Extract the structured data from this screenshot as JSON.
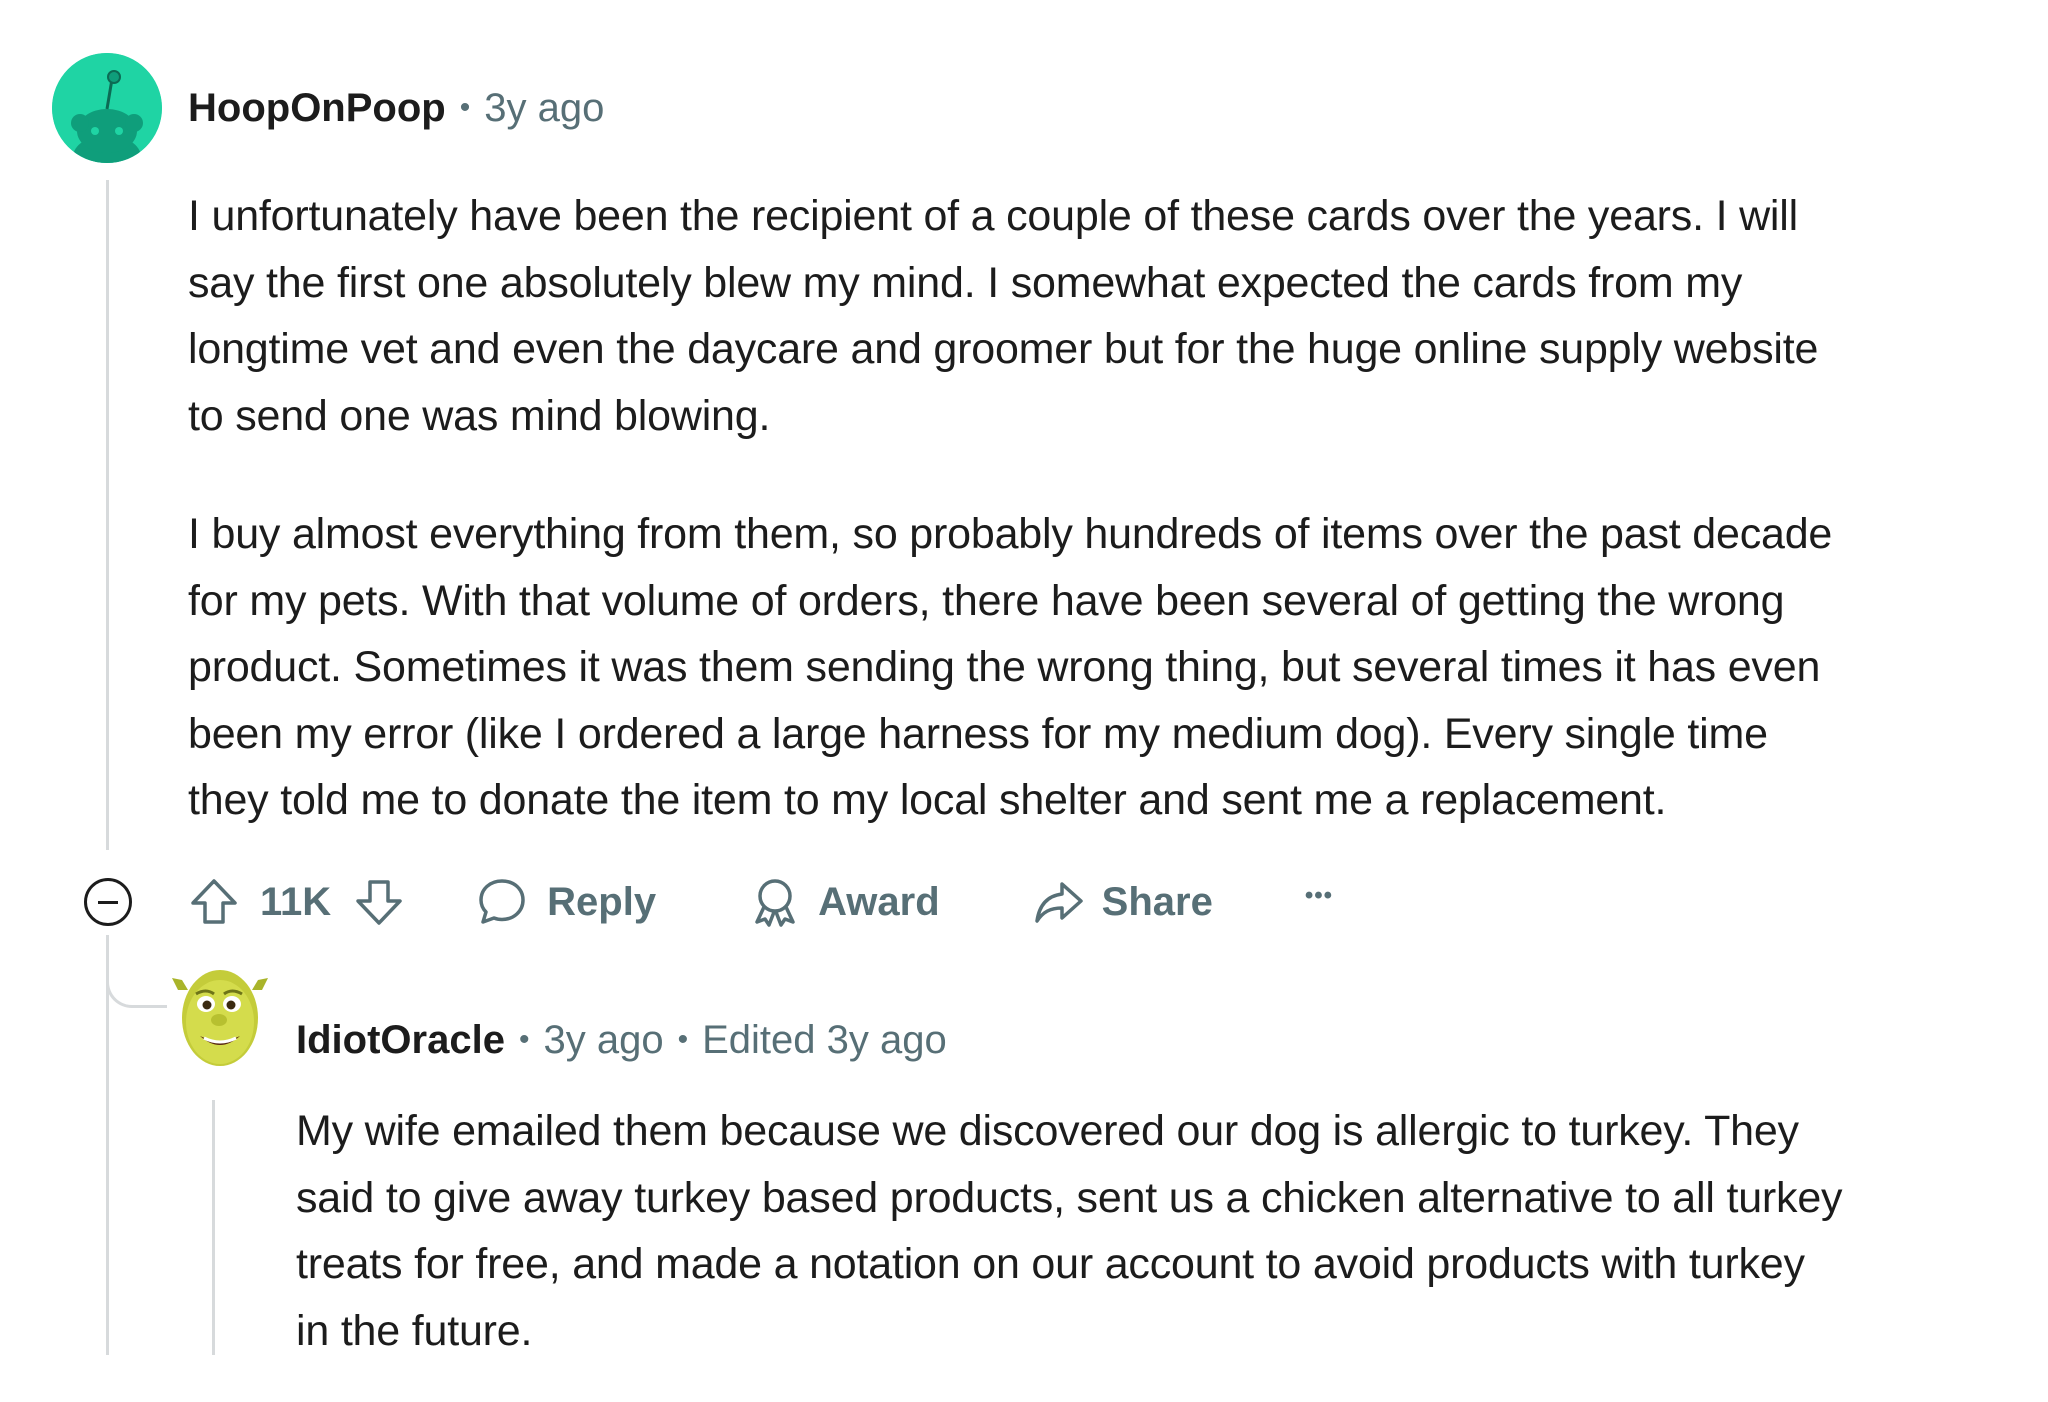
{
  "comment": {
    "username": "HoopOnPoop",
    "separator": "•",
    "time": "3y ago",
    "avatar_icon": "snoo-avatar-icon",
    "avatar_color": "#1fd4a4",
    "body": {
      "paragraph1": [
        "I unfortunately have been the recipient of a couple of these cards over the years. I will",
        "say the first one absolutely blew my mind. I somewhat expected the cards from my",
        "longtime vet and even the daycare and groomer but for the huge online supply website",
        "to send one was mind blowing."
      ],
      "paragraph2": [
        "I buy almost everything from them, so probably hundreds of items over the past decade",
        "for my pets. With that volume of orders, there have been several of getting the wrong",
        "product. Sometimes it was them sending the wrong thing, but several times it has even",
        "been my error (like I ordered a large harness for my medium dog). Every single time",
        "they told me to donate the item to my local shelter and sent me a replacement."
      ]
    },
    "actions": {
      "vote_count": "11K",
      "reply_label": "Reply",
      "award_label": "Award",
      "share_label": "Share",
      "more_label": "•••"
    }
  },
  "reply": {
    "username": "IdiotOracle",
    "separator": "•",
    "time": "3y ago",
    "edited": "Edited 3y ago",
    "avatar_icon": "shrek-face-avatar-icon",
    "body": [
      "My wife emailed them because we discovered our dog is allergic to turkey. They",
      "said to give away turkey based products, sent us a chicken alternative to all turkey",
      "treats for free, and made a notation on our account to avoid products with turkey",
      "in the future."
    ]
  },
  "colors": {
    "text": "#1c1c1c",
    "meta": "#576f76",
    "thread_line": "#d7dadc"
  }
}
